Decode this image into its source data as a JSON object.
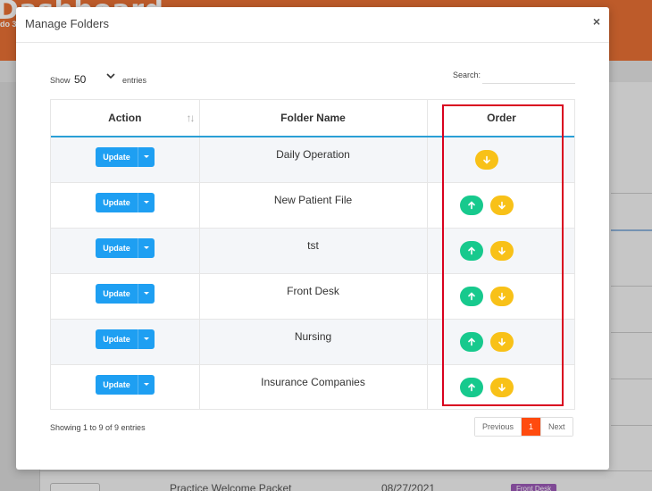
{
  "background": {
    "app_title": "Dashboard",
    "app_subtitle": "do 3",
    "bottom_row": {
      "name": "Practice Welcome Packet",
      "date": "08/27/2021",
      "badge": "Front Desk"
    }
  },
  "modal": {
    "title": "Manage Folders",
    "close_symbol": "×"
  },
  "controls": {
    "show_label": "Show",
    "show_value": "50",
    "entries_label": "entries",
    "search_label": "Search:",
    "search_value": "",
    "search_placeholder": ""
  },
  "table": {
    "headers": {
      "action": "Action",
      "folder_name": "Folder Name",
      "order": "Order"
    },
    "rows": [
      {
        "update_label": "Update",
        "folder_name": "Daily Operation",
        "has_up": false,
        "has_down": true
      },
      {
        "update_label": "Update",
        "folder_name": "New Patient File",
        "has_up": true,
        "has_down": true
      },
      {
        "update_label": "Update",
        "folder_name": "tst",
        "has_up": true,
        "has_down": true
      },
      {
        "update_label": "Update",
        "folder_name": "Front Desk",
        "has_up": true,
        "has_down": true
      },
      {
        "update_label": "Update",
        "folder_name": "Nursing",
        "has_up": true,
        "has_down": true
      },
      {
        "update_label": "Update",
        "folder_name": "Insurance Companies",
        "has_up": true,
        "has_down": true
      }
    ]
  },
  "footer": {
    "showing_text": "Showing 1 to 9 of 9 entries",
    "pagination": {
      "previous": "Previous",
      "current": "1",
      "next": "Next"
    }
  },
  "colors": {
    "primary_blue": "#1e9ff2",
    "up_green": "#17c98d",
    "down_yellow": "#f8c118",
    "active_page": "#ff4b0f",
    "highlight_red": "#d9021f"
  },
  "icons": {
    "sort": "sort-arrows-icon",
    "up": "arrow-up-icon",
    "down": "arrow-down-icon",
    "close": "close-icon",
    "dropdown": "caret-down-icon"
  }
}
